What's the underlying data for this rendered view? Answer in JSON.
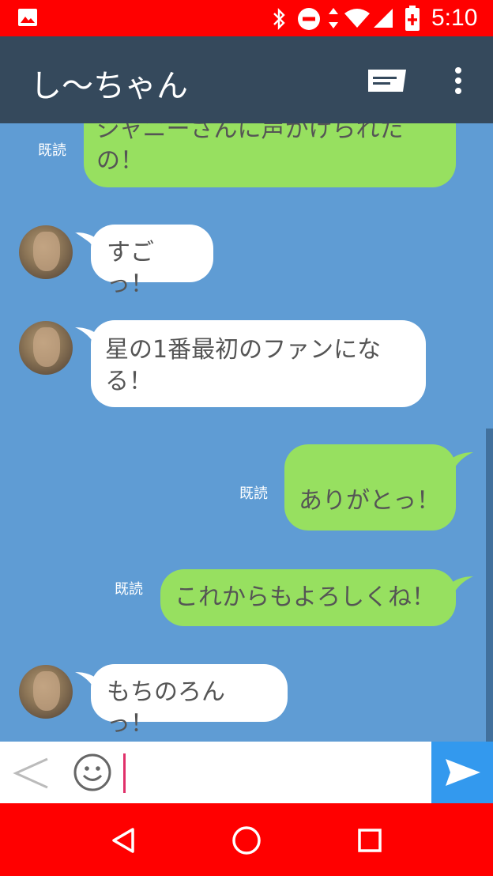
{
  "status_bar": {
    "time": "5:10"
  },
  "header": {
    "title": "し〜ちゃん"
  },
  "messages": [
    {
      "side": "out",
      "text": "ジャニーさんに声かけられたの！",
      "read": "既読"
    },
    {
      "side": "in",
      "text": "すごっ！"
    },
    {
      "side": "in",
      "text": "星の1番最初のファンになる！"
    },
    {
      "side": "out",
      "text": "ありがとっ！",
      "read": "既読"
    },
    {
      "side": "out",
      "text": "これからもよろしくね！",
      "read": "既読"
    },
    {
      "side": "in",
      "text": "もちのろんっ！"
    }
  ],
  "input": {
    "value": ""
  },
  "colors": {
    "status": "#ff0000",
    "appbar": "#35495c",
    "chat_bg": "#5f9cd4",
    "outgoing": "#97e060",
    "send": "#3399ee"
  },
  "icons": [
    "image-icon",
    "bluetooth-icon",
    "dnd-icon",
    "data-arrows-icon",
    "wifi-icon",
    "signal-icon",
    "battery-icon",
    "message-icon",
    "more-vert-icon",
    "back-chevron-icon",
    "emoji-icon",
    "send-icon",
    "nav-back-icon",
    "nav-home-icon",
    "nav-recents-icon"
  ]
}
